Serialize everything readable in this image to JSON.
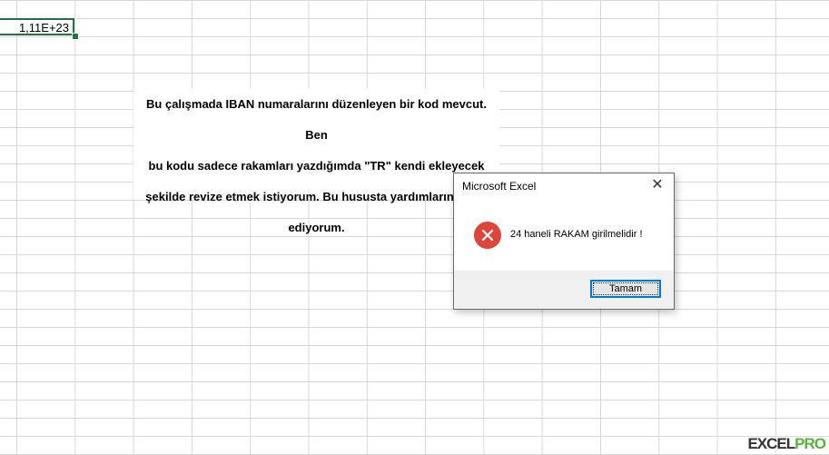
{
  "sheet": {
    "active_cell_value": "1,11E+23",
    "note_lines": [
      "Bu çalışmada IBAN numaralarını düzenleyen bir kod mevcut. Ben",
      "bu kodu sadece rakamları yazdığımda \"TR\" kendi ekleyecek",
      "şekilde revize etmek istiyorum. Bu hususta yardımlarınız rica",
      "ediyorum."
    ]
  },
  "dialog": {
    "title": "Microsoft Excel",
    "message": "24 haneli RAKAM girilmelidir !",
    "ok_label": "Tamam",
    "close_icon": "close-icon",
    "status_icon": "error-icon"
  },
  "watermark": {
    "text_main": "EXCEL",
    "text_accent": "PRO"
  },
  "colors": {
    "selection": "#217346",
    "error": "#e0453b",
    "button_focus": "#0078d7"
  }
}
